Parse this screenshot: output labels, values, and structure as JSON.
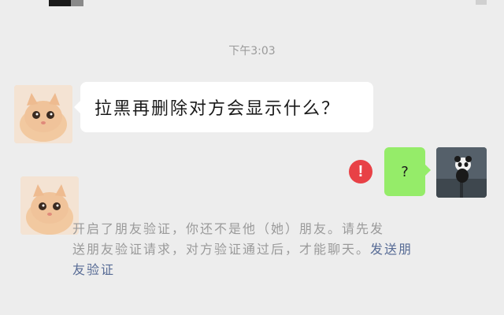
{
  "chat": {
    "timestamp": "下午3:03",
    "messages": [
      {
        "side": "left",
        "avatar": "cat-avatar",
        "text": "拉黑再删除对方会显示什么？"
      },
      {
        "side": "right",
        "avatar": "panda-avatar",
        "text": "?",
        "status": "error-icon"
      }
    ],
    "system": {
      "line1": "开启了朋友验证，你还不是他（她）朋友。请先发",
      "line2_before": "送朋友验证请求，对方验证通过后，才能聊天。",
      "link_line2": "发送朋",
      "link_line3": "友验证"
    },
    "error_symbol": "!"
  },
  "colors": {
    "background": "#ededed",
    "my_bubble": "#95ec69",
    "their_bubble": "#ffffff",
    "error": "#e84146",
    "link": "#576b95",
    "system_text": "#9a9a9a"
  }
}
